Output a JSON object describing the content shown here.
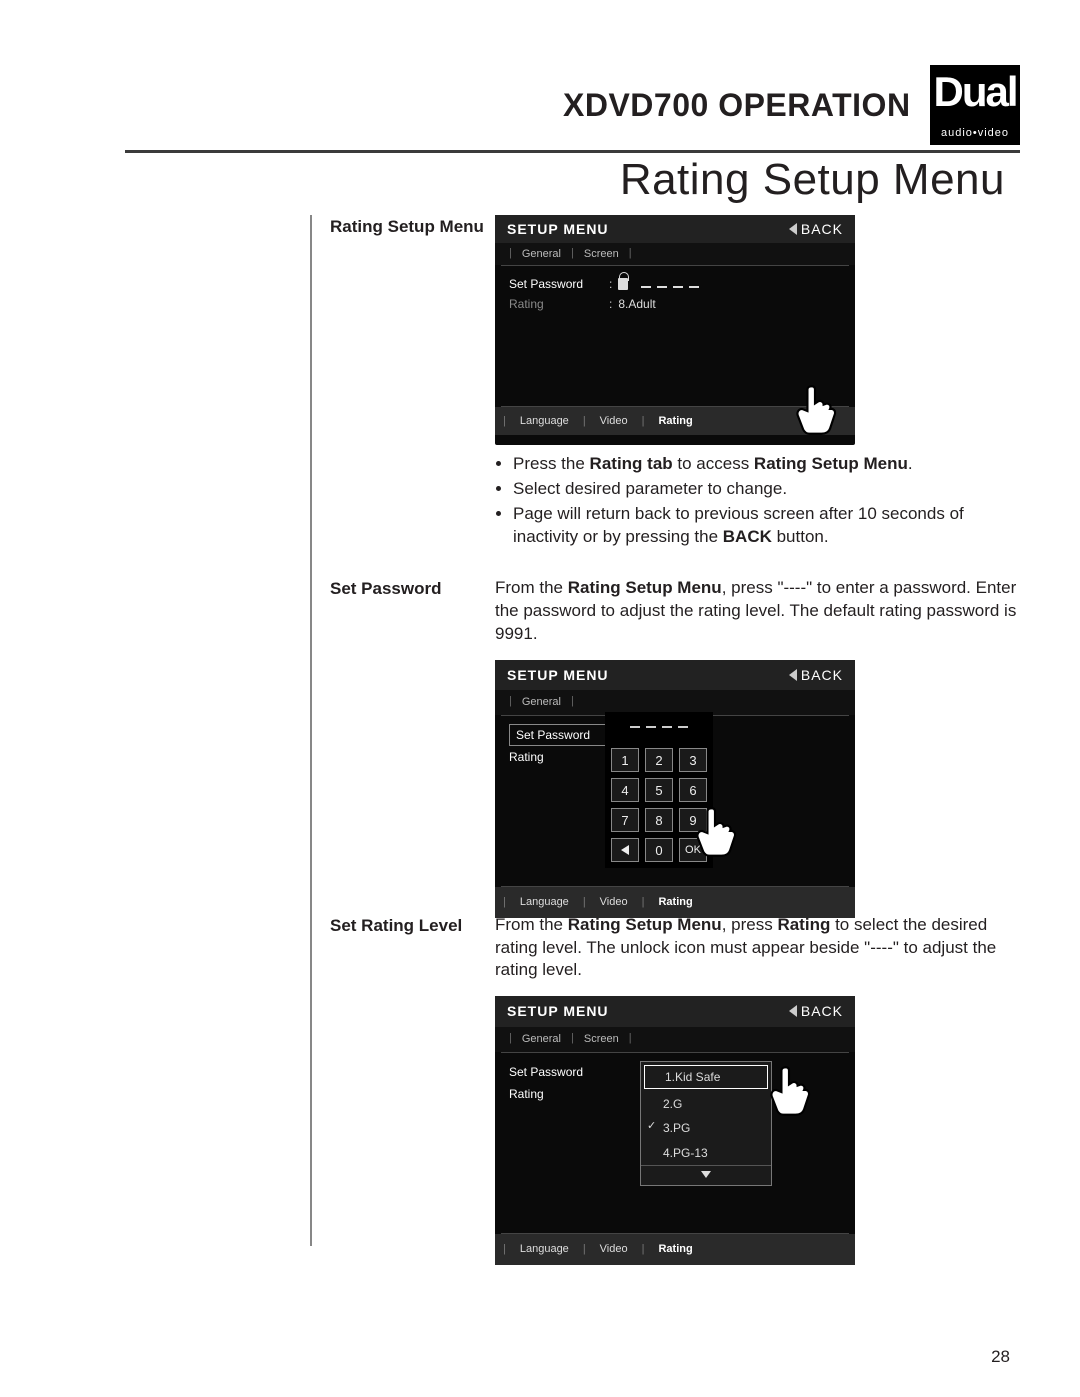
{
  "header": {
    "model": "XDVD700",
    "operation": "OPERATION",
    "brand_big": "Dual",
    "brand_sub": "audio•video"
  },
  "page_title": "Rating Setup Menu",
  "page_number": "28",
  "sec1": {
    "heading": "Rating Setup Menu",
    "bullet1a": "Press the ",
    "bullet1b": "Rating tab",
    "bullet1c": " to access ",
    "bullet1d": "Rating Setup Menu",
    "bullet1e": ".",
    "bullet2": "Select desired parameter to change.",
    "bullet3a": "Page will return back to previous screen after 10 seconds of inactivity or by pressing the ",
    "bullet3b": "BACK",
    "bullet3c": " button."
  },
  "sec2": {
    "heading": "Set Password",
    "t1": "From the ",
    "t2": "Rating Setup Menu",
    "t3": ", press \"----\" to enter a password. Enter the password to adjust the rating level. The default rating password is 9991."
  },
  "sec3": {
    "heading": "Set Rating Level",
    "t1": "From the ",
    "t2": "Rating Setup Menu",
    "t3": ", press ",
    "t4": "Rating",
    "t5": " to select the desired rating level. The unlock icon must appear beside \"----\" to adjust the rating level."
  },
  "screen_common": {
    "title": "SETUP MENU",
    "back": "BACK",
    "top_tabs": {
      "general": "General",
      "screen": "Screen"
    },
    "rows": {
      "set_password": "Set Password",
      "rating": "Rating"
    },
    "rating_value": "8.Adult",
    "bottom_tabs": {
      "language": "Language",
      "video": "Video",
      "rating": "Rating"
    }
  },
  "keypad": {
    "keys": [
      "1",
      "2",
      "3",
      "4",
      "5",
      "6",
      "7",
      "8",
      "9",
      "←",
      "0",
      "OK"
    ]
  },
  "rating_popup": {
    "options": [
      "1.Kid Safe",
      "2.G",
      "3.PG",
      "4.PG-13"
    ],
    "selected_index": 0,
    "checked_index": 2
  }
}
